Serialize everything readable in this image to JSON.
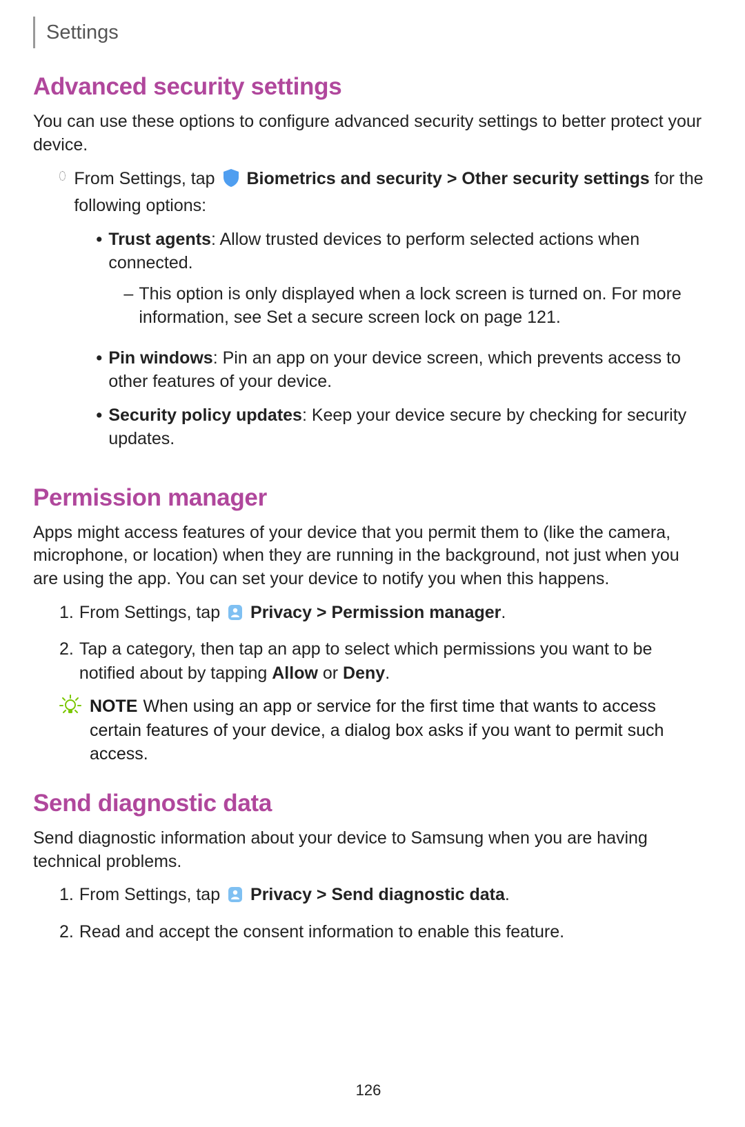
{
  "header": {
    "title": "Settings"
  },
  "sections": [
    {
      "heading": "Advanced security settings",
      "intro": "You can use these options to configure advanced security settings to better protect your device.",
      "lead_before_icon": "From Settings, tap ",
      "lead_bold": "Biometrics and security > Other security settings",
      "lead_after": " for the following options:",
      "bullets": [
        {
          "bold": "Trust agents",
          "rest": ": Allow trusted devices to perform selected actions when connected.",
          "sub_before": "This option is only displayed when a lock screen is turned on. For more information, see ",
          "sub_link": "Set a secure screen lock",
          "sub_after": " on page 121."
        },
        {
          "bold": "Pin windows",
          "rest": ": Pin an app on your device screen, which prevents access to other features of your device."
        },
        {
          "bold": "Security policy updates",
          "rest": ": Keep your device secure by checking for security updates."
        }
      ]
    },
    {
      "heading": "Permission manager",
      "intro": "Apps might access features of your device that you permit them to (like the camera, microphone, or location) when they are running in the background, not just when you are using the app. You can set your device to notify you when this happens.",
      "steps": [
        {
          "num": "1.",
          "before_icon": "From Settings, tap ",
          "bold": "Privacy > Permission manager",
          "after": "."
        },
        {
          "num": "2.",
          "plain_before": "Tap a category, then tap an app to select which permissions you want to be notified about by tapping ",
          "bold1": "Allow",
          "mid": " or ",
          "bold2": "Deny",
          "after": "."
        }
      ],
      "note_label": "NOTE",
      "note_text": "When using an app or service for the first time that wants to access certain features of your device, a dialog box asks if you want to permit such access."
    },
    {
      "heading": "Send diagnostic data",
      "intro": "Send diagnostic information about your device to Samsung when you are having technical problems.",
      "steps": [
        {
          "num": "1.",
          "before_icon": "From Settings, tap ",
          "bold": "Privacy > Send diagnostic data",
          "after": "."
        },
        {
          "num": "2.",
          "plain": "Read and accept the consent information to enable this feature."
        }
      ]
    }
  ],
  "page_number": "126"
}
